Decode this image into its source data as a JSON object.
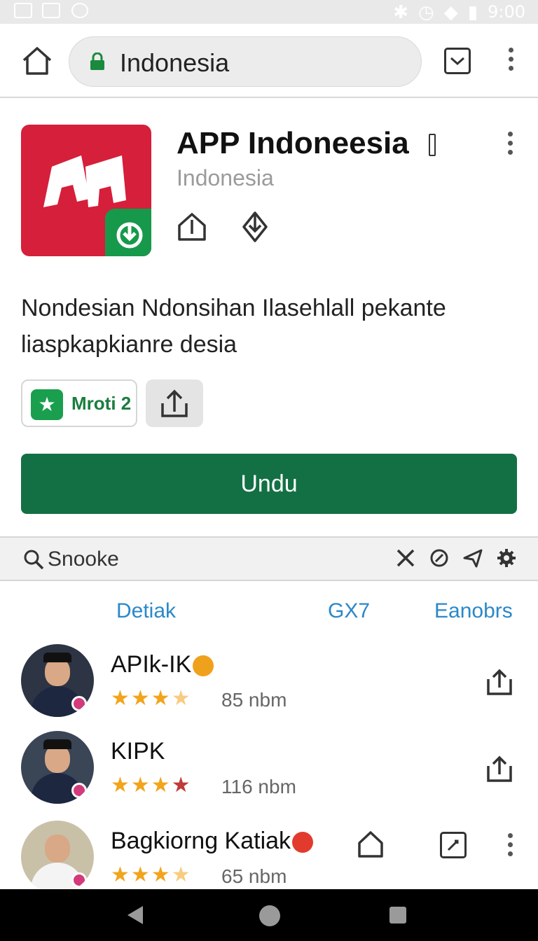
{
  "status_bar": {
    "time": "9:00"
  },
  "browser": {
    "url": "Indonesia"
  },
  "app": {
    "title": "APP Indoneesia",
    "subtitle": "Indonesia",
    "description_line1": "Nondesian Ndonsihan Ilasehlall pekante",
    "description_line2": "liaspkapkianre desia",
    "badge_label": "Mroti 2",
    "primary_button": "Undu"
  },
  "search": {
    "text": "Snooke"
  },
  "tabs": [
    "Detiak",
    "GX7",
    "Eanobrs"
  ],
  "list": [
    {
      "name": "APIk-IK",
      "rating": 3.5,
      "meta": "85 nbm"
    },
    {
      "name": "KIPK",
      "rating": 3.5,
      "meta": "116 nbm"
    },
    {
      "name": "Bagkiorng Katiak",
      "rating": 3.5,
      "meta": "65 nbm"
    }
  ],
  "colors": {
    "primary_green": "#137044",
    "app_icon_red": "#d61f3a",
    "tab_blue": "#2b88c9",
    "star_gold": "#f2a41b"
  }
}
